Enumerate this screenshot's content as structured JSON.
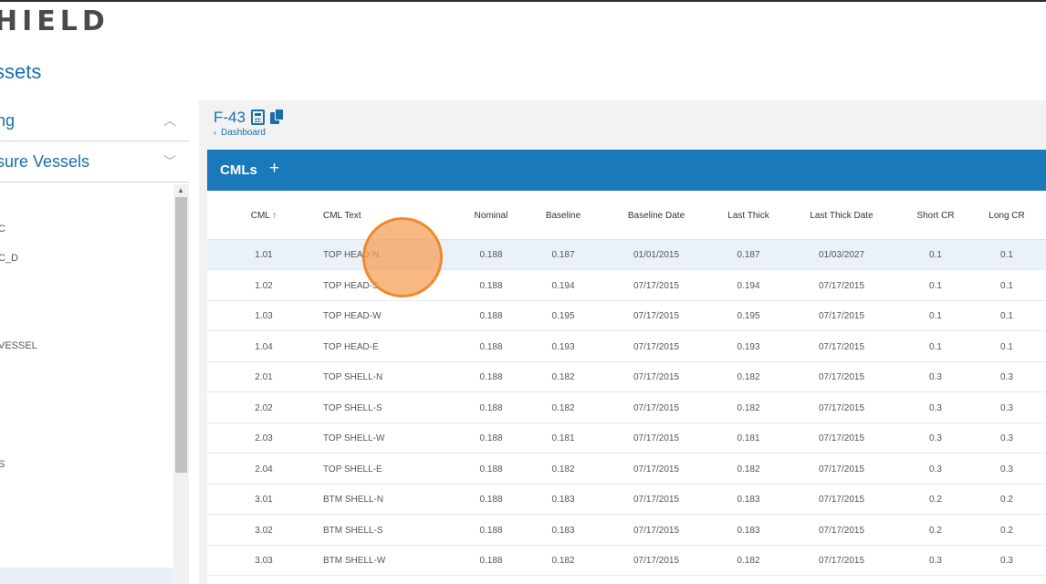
{
  "brand": {
    "logo_text": "HIELD"
  },
  "page": {
    "title": "ssets"
  },
  "sidebar": {
    "sections": [
      {
        "label": "ng",
        "chevron": "chevron-up-icon"
      },
      {
        "label": "sure Vessels",
        "chevron": "chevron-down-icon"
      }
    ],
    "tree_items": [
      "C",
      "C_D",
      "VESSEL",
      "S"
    ]
  },
  "asset": {
    "title": "F-43",
    "breadcrumb": "Dashboard"
  },
  "cml_panel": {
    "title": "CMLs",
    "add_label": "+",
    "columns": [
      "CML",
      "CML Text",
      "Nominal",
      "Baseline",
      "Baseline Date",
      "Last Thick",
      "Last Thick Date",
      "Short CR",
      "Long CR"
    ],
    "sort_indicator": "↑",
    "rows": [
      [
        "1.01",
        "TOP HEAD-N",
        "0.188",
        "0.187",
        "01/01/2015",
        "0.187",
        "01/03/2027",
        "0.1",
        "0.1"
      ],
      [
        "1.02",
        "TOP HEAD-S",
        "0.188",
        "0.194",
        "07/17/2015",
        "0.194",
        "07/17/2015",
        "0.1",
        "0.1"
      ],
      [
        "1.03",
        "TOP HEAD-W",
        "0.188",
        "0.195",
        "07/17/2015",
        "0.195",
        "07/17/2015",
        "0.1",
        "0.1"
      ],
      [
        "1.04",
        "TOP HEAD-E",
        "0.188",
        "0.193",
        "07/17/2015",
        "0.193",
        "07/17/2015",
        "0.1",
        "0.1"
      ],
      [
        "2.01",
        "TOP SHELL-N",
        "0.188",
        "0.182",
        "07/17/2015",
        "0.182",
        "07/17/2015",
        "0.3",
        "0.3"
      ],
      [
        "2.02",
        "TOP SHELL-S",
        "0.188",
        "0.182",
        "07/17/2015",
        "0.182",
        "07/17/2015",
        "0.3",
        "0.3"
      ],
      [
        "2.03",
        "TOP SHELL-W",
        "0.188",
        "0.181",
        "07/17/2015",
        "0.181",
        "07/17/2015",
        "0.3",
        "0.3"
      ],
      [
        "2.04",
        "TOP SHELL-E",
        "0.188",
        "0.182",
        "07/17/2015",
        "0.182",
        "07/17/2015",
        "0.3",
        "0.3"
      ],
      [
        "3.01",
        "BTM SHELL-N",
        "0.188",
        "0.183",
        "07/17/2015",
        "0.183",
        "07/17/2015",
        "0.2",
        "0.2"
      ],
      [
        "3.02",
        "BTM SHELL-S",
        "0.188",
        "0.183",
        "07/17/2015",
        "0.183",
        "07/17/2015",
        "0.2",
        "0.2"
      ],
      [
        "3.03",
        "BTM SHELL-W",
        "0.188",
        "0.182",
        "07/17/2015",
        "0.182",
        "07/17/2015",
        "0.3",
        "0.3"
      ]
    ]
  },
  "colors": {
    "accent": "#1a79b8",
    "title_blue": "#1a6ea8",
    "cursor": "#ee8a2c"
  }
}
